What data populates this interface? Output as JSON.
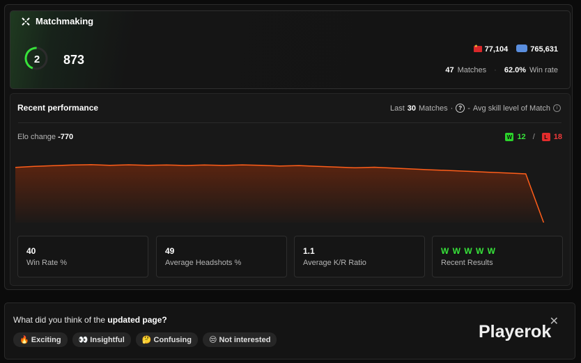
{
  "matchmaking": {
    "title": "Matchmaking",
    "level": "2",
    "elo": "873",
    "level_progress": 0.45,
    "region_rank": "77,104",
    "world_rank": "765,631",
    "matches": "47",
    "matches_label": "Matches",
    "win_rate": "62.0%",
    "win_rate_label": "Win rate",
    "colors": {
      "accent": "#37e33a",
      "region_flag": "#d9282a",
      "world_flag": "#5a8ede"
    }
  },
  "performance": {
    "title": "Recent performance",
    "last_label": "Last",
    "last_count": "30",
    "matches_label": "Matches",
    "skill_icon_text": "?",
    "avg_skill_label": "Avg skill level of Match",
    "elo_change_label": "Elo change",
    "elo_change_value": "-770",
    "wins_badge": "W",
    "wins": "12",
    "losses_badge": "L",
    "losses": "18",
    "cards": [
      {
        "value": "40",
        "label": "Win Rate %"
      },
      {
        "value": "49",
        "label": "Average Headshots %"
      },
      {
        "value": "1.1",
        "label": "Average K/R Ratio"
      },
      {
        "value": "W W W W W",
        "label": "Recent Results"
      }
    ]
  },
  "chart_data": {
    "type": "area",
    "x": [
      1,
      2,
      3,
      4,
      5,
      6,
      7,
      8,
      9,
      10,
      11,
      12,
      13,
      14,
      15,
      16,
      17,
      18,
      19,
      20,
      21,
      22,
      23,
      24,
      25,
      26,
      27,
      28,
      29,
      30
    ],
    "values": [
      873,
      888,
      898,
      907,
      912,
      903,
      910,
      902,
      908,
      900,
      907,
      901,
      909,
      902,
      893,
      899,
      887,
      878,
      867,
      875,
      862,
      850,
      838,
      828,
      816,
      804,
      792,
      780,
      38,
      15
    ],
    "ylim": [
      0,
      1000
    ],
    "grid": false,
    "colors": {
      "line": "#ff5e1a",
      "fill_top": "#5a2410",
      "fill_bottom": "#181818"
    }
  },
  "feedback": {
    "question_prefix": "What did you think of the",
    "question_bold": "updated page?",
    "options": [
      "🔥 Exciting",
      "👀 Insightful",
      "🤔 Confusing",
      "😒 Not interested"
    ],
    "brand": "Playerok",
    "close_icon": "close-icon"
  }
}
